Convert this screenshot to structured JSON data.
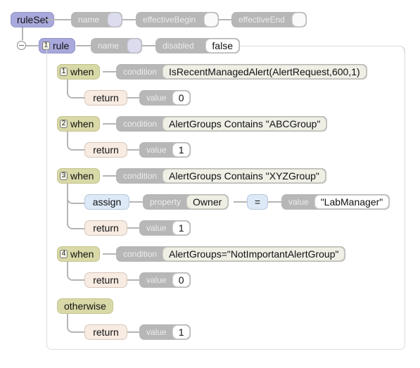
{
  "ruleSet": {
    "label": "ruleSet",
    "props": [
      {
        "name": "name",
        "value": ""
      },
      {
        "name": "effectiveBegin",
        "value": ""
      },
      {
        "name": "effectiveEnd",
        "value": ""
      }
    ]
  },
  "rule": {
    "index": "1",
    "label": "rule",
    "props": [
      {
        "name": "name",
        "value": ""
      },
      {
        "name": "disabled",
        "value": "false"
      }
    ],
    "whens": [
      {
        "index": "1",
        "label": "when",
        "condition_label": "condition",
        "condition": "IsRecentManagedAlert(AlertRequest,600,1)",
        "actions": [
          {
            "type": "return",
            "label": "return",
            "value_label": "value",
            "value": "0"
          }
        ]
      },
      {
        "index": "2",
        "label": "when",
        "condition_label": "condition",
        "condition": "AlertGroups Contains \"ABCGroup\"",
        "actions": [
          {
            "type": "return",
            "label": "return",
            "value_label": "value",
            "value": "1"
          }
        ]
      },
      {
        "index": "3",
        "label": "when",
        "condition_label": "condition",
        "condition": "AlertGroups Contains \"XYZGroup\"",
        "actions": [
          {
            "type": "assign",
            "label": "assign",
            "property_label": "property",
            "property": "Owner",
            "operator": "=",
            "value_label": "value",
            "value": "\"LabManager\""
          },
          {
            "type": "return",
            "label": "return",
            "value_label": "value",
            "value": "1"
          }
        ]
      },
      {
        "index": "4",
        "label": "when",
        "condition_label": "condition",
        "condition": "AlertGroups=\"NotImportantAlertGroup\"",
        "actions": [
          {
            "type": "return",
            "label": "return",
            "value_label": "value",
            "value": "0"
          }
        ]
      }
    ],
    "otherwise": {
      "label": "otherwise",
      "actions": [
        {
          "type": "return",
          "label": "return",
          "value_label": "value",
          "value": "1"
        }
      ]
    }
  }
}
